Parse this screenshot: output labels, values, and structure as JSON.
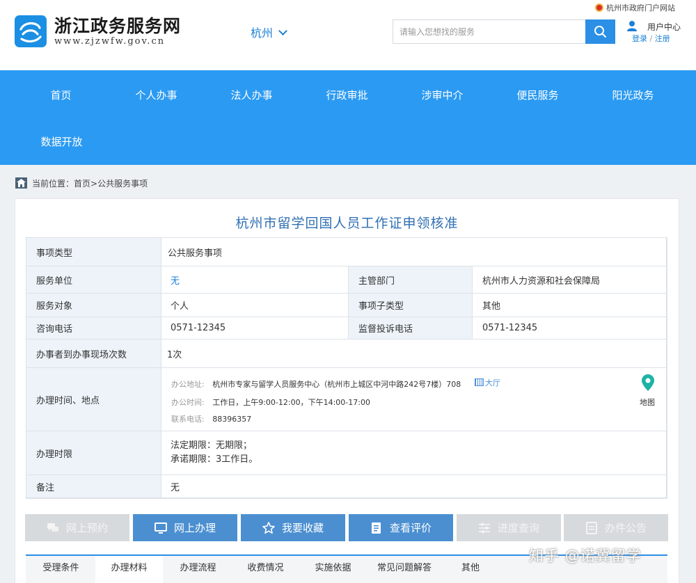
{
  "header": {
    "site_name": "浙江政务服务网",
    "site_url": "www.zjzwfw.gov.cn",
    "city": "杭州",
    "gov_portal_link": "杭州市政府门户网站",
    "search_placeholder": "请输入您想找的服务",
    "user_center": "用户中心",
    "login": "登录",
    "separator": "/",
    "register": "注册"
  },
  "nav": {
    "items": [
      "首页",
      "个人办事",
      "法人办事",
      "行政审批",
      "涉审中介",
      "便民服务",
      "阳光政务",
      "数据开放"
    ]
  },
  "breadcrumb": {
    "prefix": "当前位置：",
    "home": "首页",
    "sep": ">",
    "current": "公共服务事项"
  },
  "page": {
    "title": "杭州市留学回国人员工作证申领核准"
  },
  "details": {
    "type_label": "事项类型",
    "type_value": "公共服务事项",
    "unit_label": "服务单位",
    "unit_value": "无",
    "dept_label": "主管部门",
    "dept_value": "杭州市人力资源和社会保障局",
    "target_label": "服务对象",
    "target_value": "个人",
    "subtype_label": "事项子类型",
    "subtype_value": "其他",
    "phone_label": "咨询电话",
    "phone_value": "0571-12345",
    "complaint_label": "监督投诉电话",
    "complaint_value": "0571-12345",
    "visits_label": "办事者到办事现场次数",
    "visits_value": "1次",
    "timeplace_label": "办理时间、地点",
    "addr_key": "办公地址:",
    "addr_value": "杭州市专家与留学人员服务中心（杭州市上城区中河中路242号7楼）708",
    "hall_tag": "大厅",
    "hours_key": "办公时间:",
    "hours_value": "工作日，上午9:00-12:00，下午14:00-17:00",
    "contact_key": "联系电话:",
    "contact_value": "88396357",
    "map_label": "地图",
    "limit_label": "办理时限",
    "limit_legal": "法定期限：无期限；",
    "limit_promise": "承诺期限：3工作日。",
    "remark_label": "备注",
    "remark_value": "无"
  },
  "actions": [
    {
      "label": "网上预约",
      "enabled": false,
      "icon": "chat-icon"
    },
    {
      "label": "网上办理",
      "enabled": true,
      "icon": "monitor-icon"
    },
    {
      "label": "我要收藏",
      "enabled": true,
      "icon": "star-icon"
    },
    {
      "label": "查看评价",
      "enabled": true,
      "icon": "document-icon"
    },
    {
      "label": "进度查询",
      "enabled": false,
      "icon": "sliders-icon"
    },
    {
      "label": "办件公告",
      "enabled": false,
      "icon": "notice-icon"
    }
  ],
  "tabs": [
    "受理条件",
    "办理材料",
    "办理流程",
    "收费情况",
    "实施依据",
    "常见问题解答",
    "其他"
  ],
  "active_tab": "办理材料",
  "watermark": "知乎 @诺冀留学",
  "colors": {
    "nav_bg": "#2b9af2",
    "accent": "#1a7fd6",
    "button_enabled": "#4b8fd1",
    "button_disabled": "#d7dadd",
    "label_bg": "#edf3f9"
  }
}
